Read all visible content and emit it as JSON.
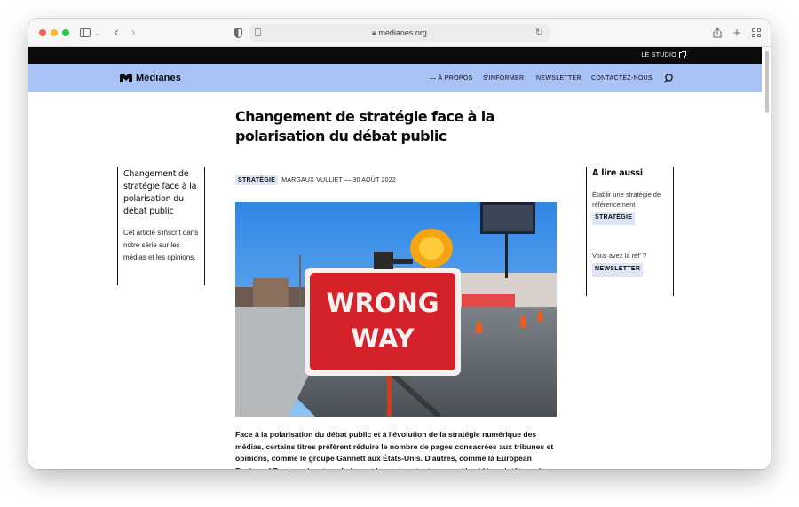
{
  "browser": {
    "url": "medianes.org",
    "controls": {
      "back": "‹",
      "forward": "›",
      "new_tab": "+"
    }
  },
  "topbar": {
    "studio_label": "LE STUDIO"
  },
  "site": {
    "logo_text": "Médianes",
    "brand_color": "#a9c2f6",
    "nav": [
      {
        "label": "— À PROPOS"
      },
      {
        "label": "S'INFORMER"
      },
      {
        "label": "NEWSLETTER"
      },
      {
        "label": "CONTACTEZ-NOUS"
      }
    ]
  },
  "article": {
    "title": "Changement de stratégie face à la polarisation du débat public",
    "tag": "STRATÉGIE",
    "byline": "MARGAUX VULLIET — 30 AOÛT 2022",
    "image_sign_text": [
      "WRONG",
      "WAY"
    ],
    "lede": "Face à la polarisation du débat public et à l'évolution de la stratégie numérique des médias, certains titres préfèrent réduire le nombre de pages consacrées aux tribunes et opinions, comme le groupe Gannett aux États-Unis. D'autres, comme la European Review of Books, misent sur le format long et mettent en avant les idées plutôt que les opinions."
  },
  "aside_left": {
    "title": "Changement de stratégie face à la polarisation du débat public",
    "text": "Cet article s'inscrit dans notre série sur les médias et les opinions."
  },
  "aside_right": {
    "heading": "À lire aussi",
    "items": [
      {
        "title": "Établir une stratégie de référencement",
        "tag": "STRATÉGIE"
      },
      {
        "title": "Vous avez la réf' ?",
        "tag": "NEWSLETTER"
      }
    ]
  }
}
